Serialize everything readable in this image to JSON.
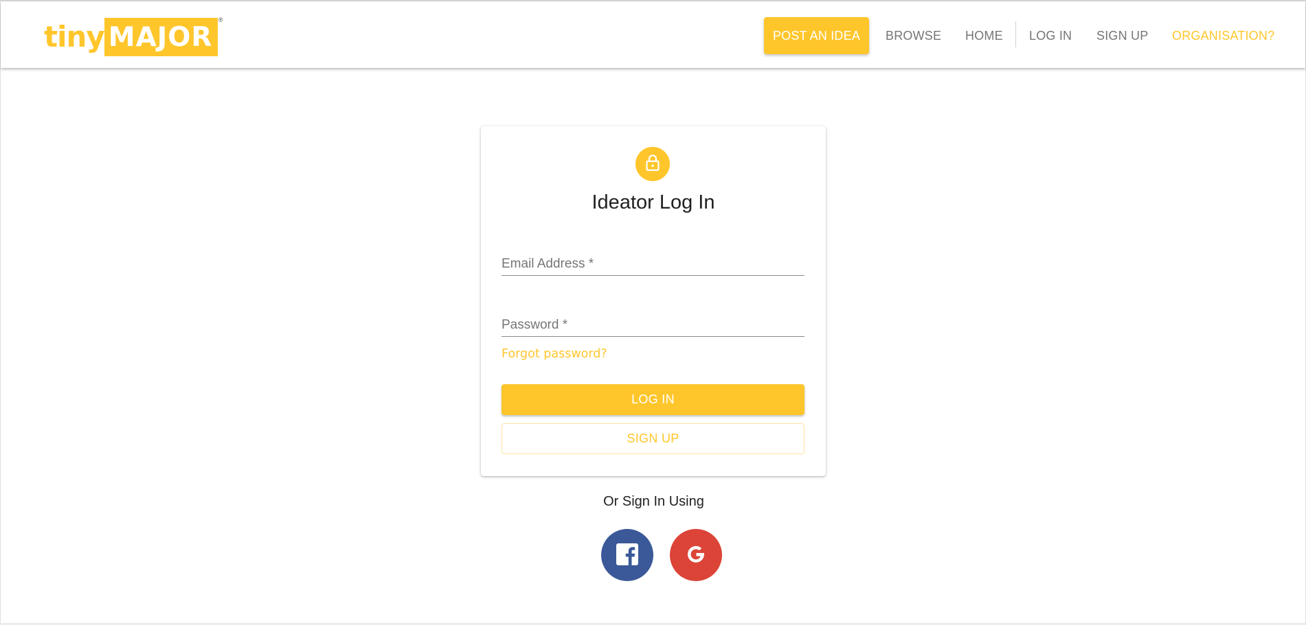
{
  "brand": {
    "logo_tiny": "tiny",
    "logo_major": "MAJOR",
    "logo_reg": "®",
    "accent_color": "#FFC62C"
  },
  "nav": {
    "post_idea": "POST AN IDEA",
    "browse": "BROWSE",
    "home": "HOME",
    "login": "LOG IN",
    "signup": "SIGN UP",
    "organisation": "ORGANISATION?"
  },
  "login_card": {
    "icon": "lock-icon",
    "title": "Ideator Log In",
    "email_placeholder": "Email Address *",
    "password_placeholder": "Password *",
    "forgot_password": "Forgot password?",
    "login_button": "LOG IN",
    "signup_button": "SIGN UP"
  },
  "social": {
    "label": "Or Sign In Using",
    "facebook_icon": "facebook-icon",
    "facebook_color": "#3B5998",
    "google_icon": "google-icon",
    "google_color": "#DB4437"
  }
}
